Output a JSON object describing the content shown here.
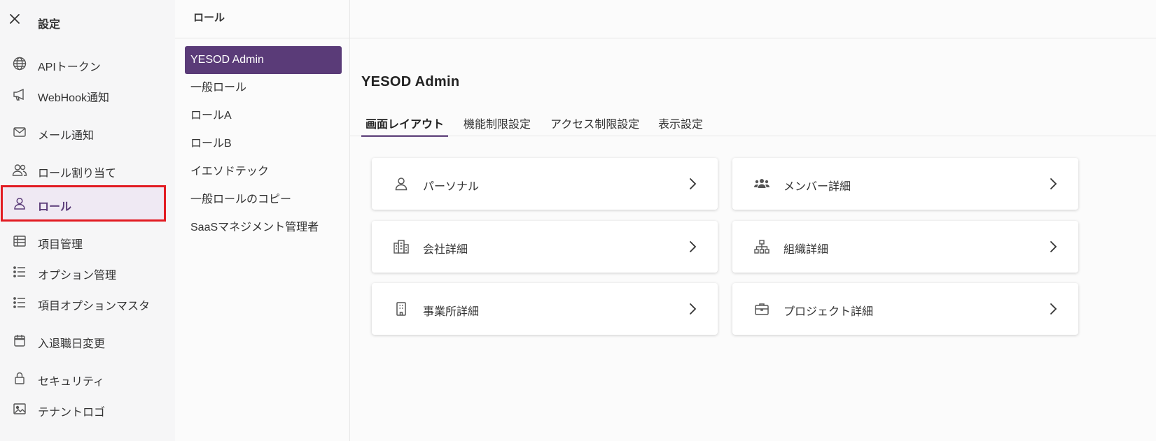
{
  "sidebar": {
    "title": "設定",
    "items": [
      {
        "label": "APIトークン",
        "icon": "globe-icon"
      },
      {
        "label": "WebHook通知",
        "icon": "megaphone-icon"
      },
      {
        "label": "メール通知",
        "icon": "mail-icon"
      },
      {
        "label": "ロール割り当て",
        "icon": "users-icon"
      },
      {
        "label": "ロール",
        "icon": "user-icon"
      },
      {
        "label": "項目管理",
        "icon": "table-icon"
      },
      {
        "label": "オプション管理",
        "icon": "list-icon"
      },
      {
        "label": "項目オプションマスタ",
        "icon": "list-icon"
      },
      {
        "label": "入退職日変更",
        "icon": "calendar-icon"
      },
      {
        "label": "セキュリティ",
        "icon": "lock-icon"
      },
      {
        "label": "テナントロゴ",
        "icon": "image-icon"
      }
    ],
    "active_index": 4
  },
  "header": {
    "title": "ロール"
  },
  "roles": {
    "items": [
      "YESOD Admin",
      "一般ロール",
      "ロールA",
      "ロールB",
      "イエソドテック",
      "一般ロールのコピー",
      "SaaSマネジメント管理者"
    ],
    "selected_index": 0
  },
  "main": {
    "title": "YESOD Admin",
    "tabs": [
      "画面レイアウト",
      "機能制限設定",
      "アクセス制限設定",
      "表示設定"
    ],
    "active_tab": 0,
    "cards": [
      {
        "label": "パーソナル",
        "icon": "person-icon"
      },
      {
        "label": "メンバー詳細",
        "icon": "group-icon"
      },
      {
        "label": "会社詳細",
        "icon": "buildings-icon"
      },
      {
        "label": "組織詳細",
        "icon": "org-chart-icon"
      },
      {
        "label": "事業所詳細",
        "icon": "building-icon"
      },
      {
        "label": "プロジェクト詳細",
        "icon": "briefcase-icon"
      }
    ]
  },
  "colors": {
    "accent": "#5a3b78",
    "highlight": "#e21b22",
    "active_bg": "#efe9f3"
  }
}
